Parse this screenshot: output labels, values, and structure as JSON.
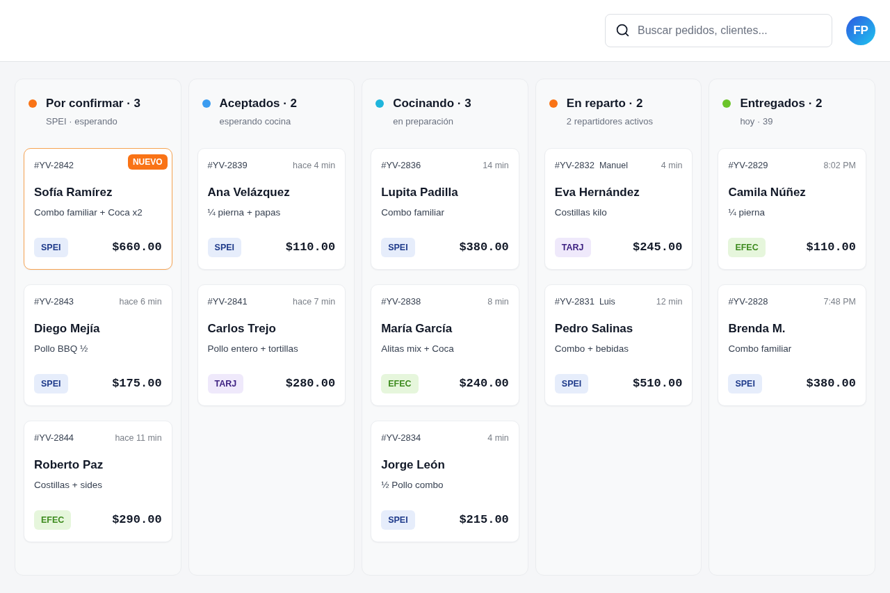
{
  "header": {
    "search": {
      "placeholder": "Buscar pedidos, clientes..."
    },
    "avatar": {
      "initials": "FP"
    }
  },
  "columns": [
    {
      "title": "Por confirmar · 3",
      "subtitle": "SPEI · esperando",
      "color": "#f97316",
      "orders": [
        {
          "id": "#YV-2842",
          "badge": "NUEVO",
          "highlighted": true,
          "customer": "Sofía Ramírez",
          "items": "Combo familiar + Coca x2",
          "payment": {
            "label": "SPEI",
            "kind": "spei"
          },
          "total": "$660.00"
        },
        {
          "id": "#YV-2843",
          "time": "hace 6 min",
          "highlighted": false,
          "customer": "Diego Mejía",
          "items": "Pollo BBQ ½",
          "payment": {
            "label": "SPEI",
            "kind": "spei"
          },
          "total": "$175.00"
        },
        {
          "id": "#YV-2844",
          "time": "hace 11 min",
          "highlighted": false,
          "customer": "Roberto Paz",
          "items": "Costillas + sides",
          "payment": {
            "label": "EFEC",
            "kind": "efec"
          },
          "total": "$290.00"
        }
      ]
    },
    {
      "title": "Aceptados · 2",
      "subtitle": "esperando cocina",
      "color": "#3b9cf0",
      "orders": [
        {
          "id": "#YV-2839",
          "time": "hace 4 min",
          "highlighted": false,
          "customer": "Ana Velázquez",
          "items": "¼ pierna + papas",
          "payment": {
            "label": "SPEI",
            "kind": "spei"
          },
          "total": "$110.00"
        },
        {
          "id": "#YV-2841",
          "time": "hace 7 min",
          "highlighted": false,
          "customer": "Carlos Trejo",
          "items": "Pollo entero + tortillas",
          "payment": {
            "label": "TARJ",
            "kind": "tarj"
          },
          "total": "$280.00"
        }
      ]
    },
    {
      "title": "Cocinando · 3",
      "subtitle": "en preparación",
      "color": "#1fb5dc",
      "orders": [
        {
          "id": "#YV-2836",
          "time": "14 min",
          "highlighted": false,
          "customer": "Lupita Padilla",
          "items": "Combo familiar",
          "payment": {
            "label": "SPEI",
            "kind": "spei"
          },
          "total": "$380.00"
        },
        {
          "id": "#YV-2838",
          "time": "8 min",
          "highlighted": false,
          "customer": "María García",
          "items": "Alitas mix + Coca",
          "payment": {
            "label": "EFEC",
            "kind": "efec"
          },
          "total": "$240.00"
        },
        {
          "id": "#YV-2834",
          "time": "4 min",
          "highlighted": false,
          "customer": "Jorge León",
          "items": "½ Pollo combo",
          "payment": {
            "label": "SPEI",
            "kind": "spei"
          },
          "total": "$215.00"
        }
      ]
    },
    {
      "title": "En reparto · 2",
      "subtitle": "2 repartidores activos",
      "color": "#f97316",
      "orders": [
        {
          "id": "#YV-2832",
          "courier": "Manuel",
          "time": "4 min",
          "highlighted": false,
          "customer": "Eva Hernández",
          "items": "Costillas kilo",
          "payment": {
            "label": "TARJ",
            "kind": "tarj"
          },
          "total": "$245.00"
        },
        {
          "id": "#YV-2831",
          "courier": "Luis",
          "time": "12 min",
          "highlighted": false,
          "customer": "Pedro Salinas",
          "items": "Combo + bebidas",
          "payment": {
            "label": "SPEI",
            "kind": "spei"
          },
          "total": "$510.00"
        }
      ]
    },
    {
      "title": "Entregados · 2",
      "subtitle": "hoy · 39",
      "color": "#6cc42a",
      "orders": [
        {
          "id": "#YV-2829",
          "time": "8:02 PM",
          "highlighted": false,
          "customer": "Camila Núñez",
          "items": "¼ pierna",
          "payment": {
            "label": "EFEC",
            "kind": "efec"
          },
          "total": "$110.00"
        },
        {
          "id": "#YV-2828",
          "time": "7:48 PM",
          "highlighted": false,
          "customer": "Brenda M.",
          "items": "Combo familiar",
          "payment": {
            "label": "SPEI",
            "kind": "spei"
          },
          "total": "$380.00"
        }
      ]
    }
  ]
}
